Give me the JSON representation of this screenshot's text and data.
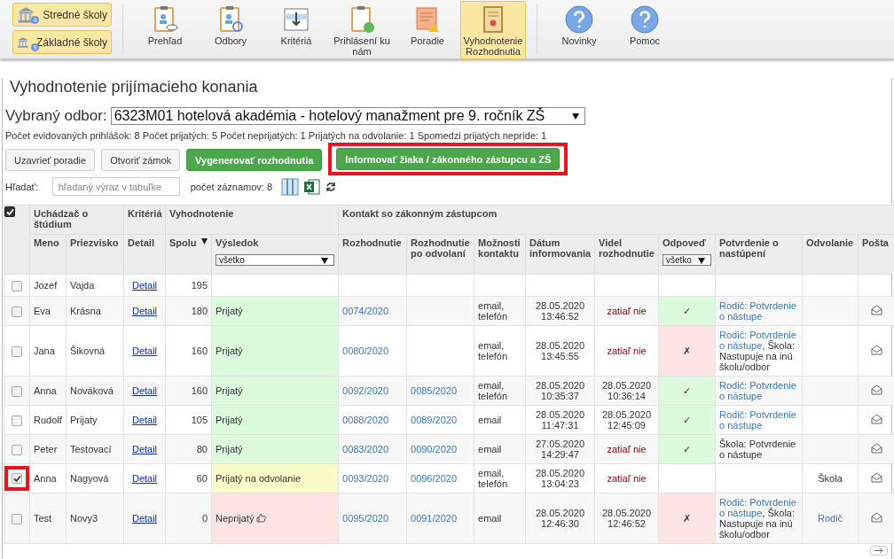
{
  "school_buttons": [
    {
      "label": "Stredné školy",
      "badge": "4"
    },
    {
      "label": "Základné školy",
      "badge": "9"
    }
  ],
  "toolbar": [
    {
      "label": "Prehľad",
      "selected": false
    },
    {
      "label": "Odbory",
      "selected": false
    },
    {
      "label": "Kritériá",
      "selected": false
    },
    {
      "label": "Prihlásení ku nám",
      "selected": false
    },
    {
      "label": "Poradie",
      "selected": false
    },
    {
      "label": "Vyhodnotenie Rozhodnutia",
      "selected": true
    }
  ],
  "help": [
    {
      "label": "Novinky"
    },
    {
      "label": "Pomoc"
    }
  ],
  "page_title": "Vyhodnotenie prijímacieho konania",
  "field": {
    "label": "Vybraný odbor:",
    "value": "6323M01 hotelová akadémia - hotelový manažment pre 9. ročník ZŠ"
  },
  "stats": "Počet evidovaných prihlášok: 8 Počet prijatých: 5 Počet neprijatých: 1 Prijatých na odvolanie: 1 Spomedzi prijatých nepríde: 1",
  "actions": [
    {
      "label": "Uzavrieť poradie",
      "kind": "plain",
      "highlighted": false
    },
    {
      "label": "Otvoriť zámok",
      "kind": "plain",
      "highlighted": false
    },
    {
      "label": "Vygenerovať rozhodnutia",
      "kind": "primary",
      "highlighted": false
    },
    {
      "label": "Informovať žiaka / zákonného zástupcu a ZŠ",
      "kind": "primary",
      "highlighted": true
    }
  ],
  "search": {
    "label": "Hľadať:",
    "placeholder": "hľadaný výraz v tabuľke",
    "count": "počet záznamov: 8"
  },
  "table": {
    "select_all_checked": true,
    "groups": [
      {
        "label": "Uchádzač o štúdium"
      },
      {
        "label": "Kritériá"
      },
      {
        "label": "Vyhodnotenie"
      },
      {
        "label": "Kontakt so zákonným zástupcom"
      }
    ],
    "columns": [
      {
        "label": "Meno",
        "sorted": false
      },
      {
        "label": "Priezvisko",
        "sorted": false
      },
      {
        "label": "Detail",
        "sorted": false
      },
      {
        "label": "Spolu",
        "sorted": true
      },
      {
        "label": "Výsledok",
        "sorted": false,
        "filter": "všetko"
      },
      {
        "label": "Rozhodnutie",
        "sorted": false
      },
      {
        "label": "Rozhodnutie po odvolaní",
        "sorted": false
      },
      {
        "label": "Možnosti kontaktu",
        "sorted": false
      },
      {
        "label": "Dátum informovania",
        "sorted": false
      },
      {
        "label": "Videl rozhodnutie",
        "sorted": false
      },
      {
        "label": "Odpoveď",
        "sorted": false,
        "filter": "všetko"
      },
      {
        "label": "Potvrdenie o nastúpení",
        "sorted": false
      },
      {
        "label": "Odvolanie",
        "sorted": false
      },
      {
        "label": "Pošta",
        "sorted": false
      }
    ],
    "rows": [
      {
        "checked": false,
        "highlighted": false,
        "first": "Jozef",
        "last": "Vajda",
        "detail": "Detail",
        "total": "195"
      },
      {
        "checked": false,
        "highlighted": false,
        "first": "Eva",
        "last": "Krásna",
        "detail": "Detail",
        "total": "180",
        "result": {
          "text": "Prijatý",
          "kind": "accepted",
          "thumb": false
        },
        "decision": "0074/2020",
        "contact": "email, telefón",
        "informed": "28.05.2020 13:46:52",
        "seen": {
          "text": "zatiaľ nie",
          "kind": "pending"
        },
        "answer": {
          "mark": "✓",
          "kind": "yes"
        },
        "confirmation": [
          {
            "kind": "link",
            "text": "Rodič: Potvrdenie o nástupe"
          }
        ],
        "mail": true
      },
      {
        "checked": false,
        "highlighted": false,
        "first": "Jana",
        "last": "Šikovná",
        "detail": "Detail",
        "total": "160",
        "result": {
          "text": "Prijatý",
          "kind": "accepted",
          "thumb": false
        },
        "decision": "0080/2020",
        "contact": "email, telefón",
        "informed": "28.05.2020 13:45:55",
        "seen": {
          "text": "zatiaľ nie",
          "kind": "pending"
        },
        "answer": {
          "mark": "✗",
          "kind": "no"
        },
        "confirmation": [
          {
            "kind": "link",
            "text": "Rodič: Potvrdenie o nástupe"
          },
          {
            "kind": "text",
            "text": ", Škola: Nastupuje na inú školu/odbor"
          }
        ],
        "mail": true
      },
      {
        "checked": false,
        "highlighted": false,
        "first": "Anna",
        "last": "Nováková",
        "detail": "Detail",
        "total": "160",
        "result": {
          "text": "Prijatý",
          "kind": "accepted",
          "thumb": false
        },
        "decision": "0092/2020",
        "appeal_decision": "0085/2020",
        "contact": "email, telefón",
        "informed": "28.05.2020 10:35:37",
        "seen": {
          "text": "28.05.2020 10:36:14",
          "kind": "date"
        },
        "answer": {
          "mark": "✓",
          "kind": "yes"
        },
        "confirmation": [
          {
            "kind": "link",
            "text": "Rodič: Potvrdenie o nástupe"
          }
        ],
        "mail": true
      },
      {
        "checked": false,
        "highlighted": false,
        "first": "Rudolf",
        "last": "Prijaty",
        "detail": "Detail",
        "total": "105",
        "result": {
          "text": "Prijatý",
          "kind": "accepted",
          "thumb": false
        },
        "decision": "0088/2020",
        "appeal_decision": "0089/2020",
        "contact": "email",
        "informed": "28.05.2020 11:47:31",
        "seen": {
          "text": "28.05.2020 12:45:09",
          "kind": "date"
        },
        "answer": {
          "mark": "✓",
          "kind": "yes"
        },
        "confirmation": [
          {
            "kind": "link",
            "text": "Rodič: Potvrdenie o nástupe"
          }
        ],
        "mail": true
      },
      {
        "checked": false,
        "highlighted": false,
        "first": "Peter",
        "last": "Testovací",
        "detail": "Detail",
        "total": "80",
        "result": {
          "text": "Prijatý",
          "kind": "accepted",
          "thumb": false
        },
        "decision": "0083/2020",
        "appeal_decision": "0090/2020",
        "contact": "email",
        "informed": "27.05.2020 14:29:47",
        "seen": {
          "text": "zatiaľ nie",
          "kind": "pending"
        },
        "answer": {
          "mark": "✓",
          "kind": "yes"
        },
        "confirmation": [
          {
            "kind": "text",
            "text": "Škola: Potvrdenie o nástupe"
          }
        ],
        "mail": true
      },
      {
        "checked": true,
        "highlighted": true,
        "first": "Anna",
        "last": "Nagyová",
        "detail": "Detail",
        "total": "60",
        "result": {
          "text": "Prijatý na odvolanie",
          "kind": "appeal",
          "thumb": false
        },
        "decision": "0093/2020",
        "appeal_decision": "0096/2020",
        "contact": "email, telefón",
        "informed": "28.05.2020 13:04:23",
        "seen": {
          "text": "zatiaľ nie",
          "kind": "pending"
        },
        "appeal": {
          "text": "Škola",
          "kind": "text"
        },
        "mail": true
      },
      {
        "checked": false,
        "highlighted": false,
        "first": "Test",
        "last": "Novy3",
        "detail": "Detail",
        "total": "0",
        "result": {
          "text": "Neprijatý",
          "kind": "rejected",
          "thumb": true
        },
        "decision": "0095/2020",
        "appeal_decision": "0091/2020",
        "contact": "email",
        "informed": "28.05.2020 12:46:30",
        "seen": {
          "text": "28.05.2020 12:46:52",
          "kind": "date"
        },
        "answer": {
          "mark": "✗",
          "kind": "no"
        },
        "confirmation": [
          {
            "kind": "link",
            "text": "Rodič: Potvrdenie o nástupe"
          },
          {
            "kind": "text",
            "text": ", Škola: Nastupuje na inú školu/odbor"
          }
        ],
        "appeal": {
          "text": "Rodič",
          "kind": "link"
        },
        "mail": true
      }
    ]
  }
}
